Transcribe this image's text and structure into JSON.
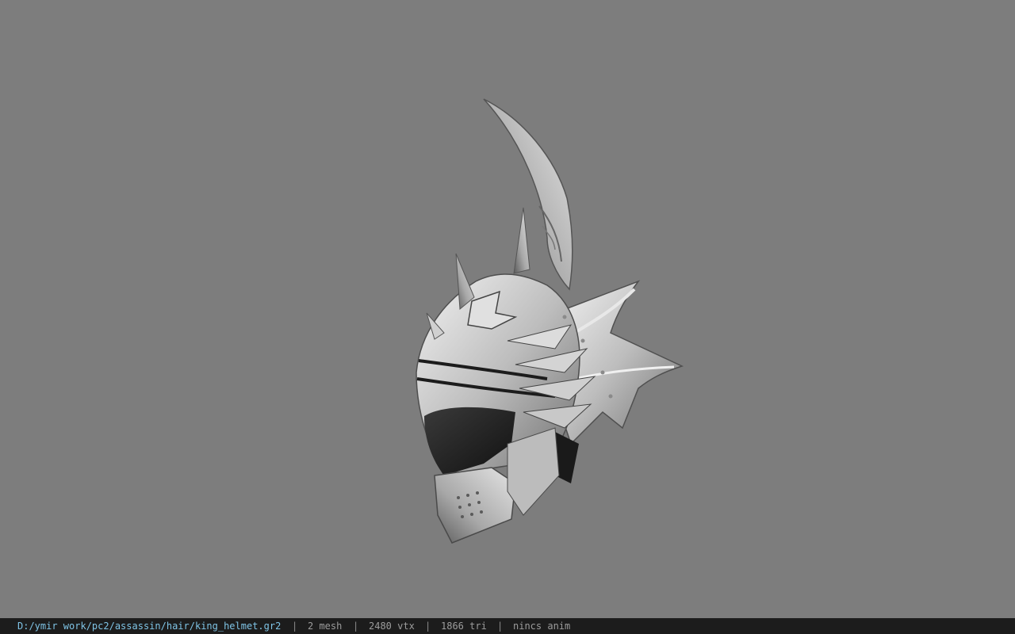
{
  "viewport": {
    "background_color": "#7d7d7d",
    "model_subject": "silver spiked helmet model"
  },
  "statusbar": {
    "file_path": "D:/ymir work/pc2/assassin/hair/king_helmet.gr2",
    "separator": "|",
    "mesh_count": "2 mesh",
    "vertex_count": "2480 vtx",
    "triangle_count": "1866 tri",
    "anim_status": "nincs anim",
    "path_color": "#7fc4e6",
    "background_color": "#1c1c1c"
  }
}
